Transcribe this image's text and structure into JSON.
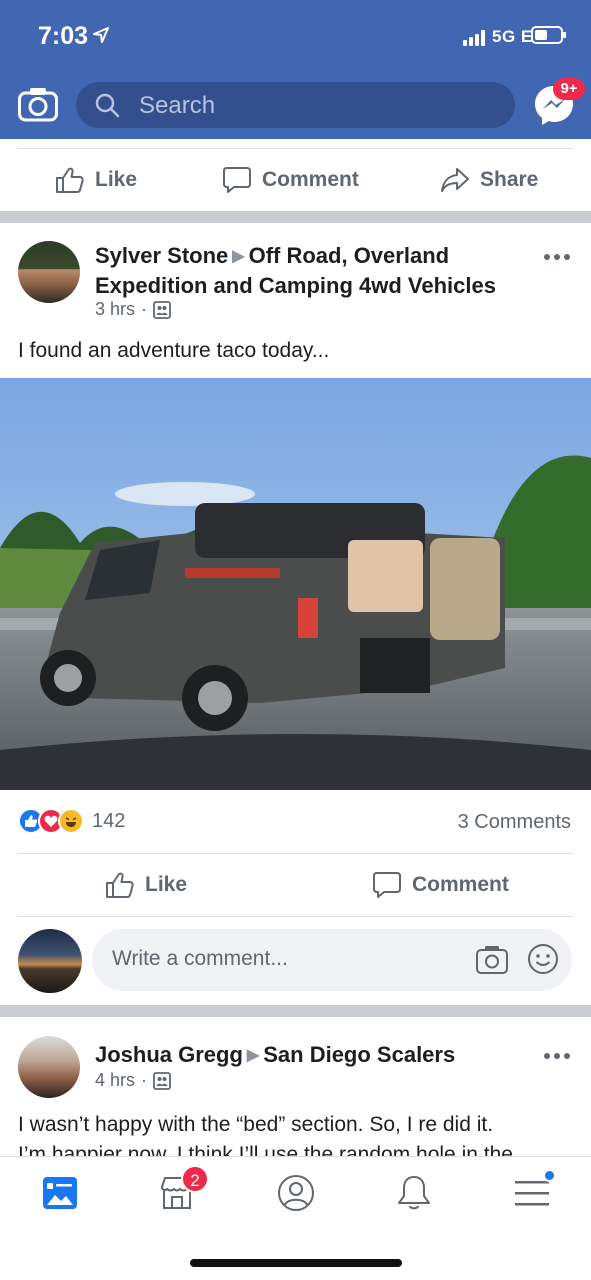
{
  "status_bar": {
    "time": "7:03",
    "network": "5G E"
  },
  "header": {
    "search_placeholder": "Search",
    "messenger_badge": "9+",
    "brand_color": "#4267b2"
  },
  "top_actions": {
    "like": "Like",
    "comment": "Comment",
    "share": "Share"
  },
  "post1": {
    "author": "Sylver Stone",
    "group": "Off Road, Overland Expedition and Camping 4wd Vehicles",
    "time": "3 hrs",
    "text": "I found an adventure taco today...",
    "reaction_count": "142",
    "comments_count": "3 Comments",
    "like_label": "Like",
    "comment_label": "Comment",
    "comment_placeholder": "Write a comment...",
    "photo_icon": "truck-photo"
  },
  "post2": {
    "author": "Joshua Gregg",
    "group": "San Diego Scalers",
    "time": "4 hrs",
    "text_line1": "I wasn’t happy with the “bed” section. So, I re did it.",
    "text_line2": "I’m happier now. I think I’ll use the random hole in the"
  },
  "tabbar": {
    "marketplace_badge": "2",
    "icons": [
      "news-feed-icon",
      "marketplace-icon",
      "profile-icon",
      "notifications-icon",
      "menu-icon"
    ]
  }
}
